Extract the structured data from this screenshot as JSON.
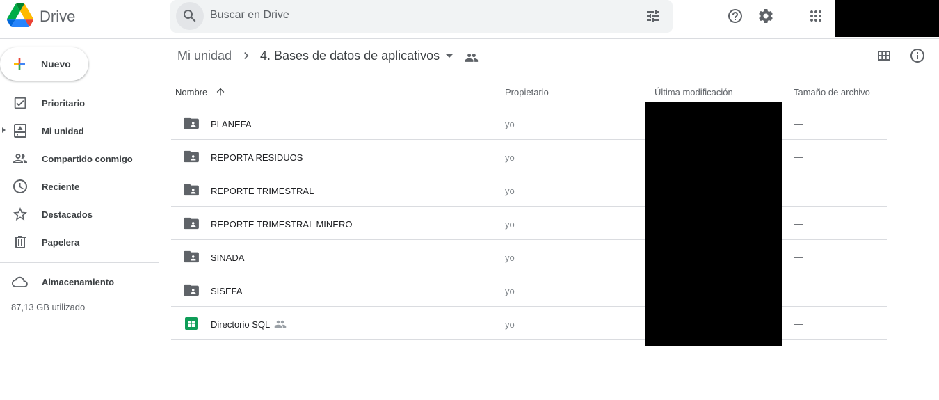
{
  "app": {
    "name": "Drive"
  },
  "search": {
    "placeholder": "Buscar en Drive"
  },
  "sidebar": {
    "new_label": "Nuevo",
    "items": [
      {
        "label": "Prioritario",
        "icon": "priority-icon"
      },
      {
        "label": "Mi unidad",
        "icon": "my-drive-icon"
      },
      {
        "label": "Compartido conmigo",
        "icon": "shared-with-me-icon"
      },
      {
        "label": "Reciente",
        "icon": "clock-icon"
      },
      {
        "label": "Destacados",
        "icon": "star-icon"
      },
      {
        "label": "Papelera",
        "icon": "trash-icon"
      }
    ],
    "storage_label": "Almacenamiento",
    "storage_used": "87,13 GB utilizado"
  },
  "breadcrumb": {
    "root": "Mi unidad",
    "current": "4. Bases de datos de aplicativos"
  },
  "table": {
    "headers": {
      "name": "Nombre",
      "owner": "Propietario",
      "modified": "Última modificación",
      "size": "Tamaño de archivo"
    },
    "rows": [
      {
        "name": "PLANEFA",
        "type": "shared-folder",
        "owner": "yo",
        "size": "—"
      },
      {
        "name": "REPORTA RESIDUOS",
        "type": "shared-folder",
        "owner": "yo",
        "size": "—"
      },
      {
        "name": "REPORTE TRIMESTRAL",
        "type": "shared-folder",
        "owner": "yo",
        "size": "—"
      },
      {
        "name": "REPORTE TRIMESTRAL MINERO",
        "type": "shared-folder",
        "owner": "yo",
        "size": "—"
      },
      {
        "name": "SINADA",
        "type": "shared-folder",
        "owner": "yo",
        "size": "—"
      },
      {
        "name": "SISEFA",
        "type": "shared-folder",
        "owner": "yo",
        "size": "—"
      },
      {
        "name": "Directorio SQL",
        "type": "spreadsheet",
        "owner": "yo",
        "size": "—",
        "shared": true
      }
    ]
  },
  "colors": {
    "accent_blue": "#1a73e8",
    "sheets_green": "#0f9d58",
    "icon_gray": "#5f6368",
    "divider": "#dadce0"
  }
}
